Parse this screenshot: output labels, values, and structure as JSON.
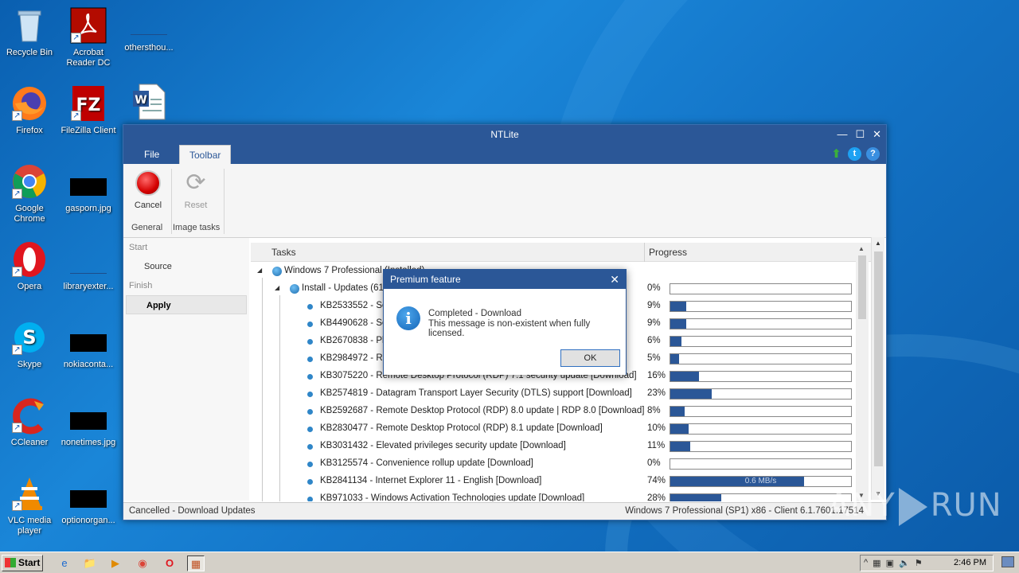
{
  "desktop": {
    "icons": [
      {
        "label": "Recycle Bin"
      },
      {
        "label": "Acrobat Reader DC"
      },
      {
        "label": "othersthou..."
      },
      {
        "label": "Firefox"
      },
      {
        "label": "FileZilla Client"
      },
      {
        "label": "Google Chrome"
      },
      {
        "label": "gasporn.jpg"
      },
      {
        "label": "Opera"
      },
      {
        "label": "libraryexter..."
      },
      {
        "label": "Skype"
      },
      {
        "label": "nokiaconta..."
      },
      {
        "label": "CCleaner"
      },
      {
        "label": "nonetimes.jpg"
      },
      {
        "label": "VLC media player"
      },
      {
        "label": "optionorgan..."
      }
    ]
  },
  "window": {
    "title": "NTLite",
    "menu": {
      "file": "File",
      "toolbar": "Toolbar"
    },
    "ribbon": {
      "cancel": "Cancel",
      "reset": "Image tasks",
      "reset_label": "Reset",
      "group_general": "General",
      "group_image_tasks": "Image tasks"
    },
    "sidenav": {
      "start": "Start",
      "source": "Source",
      "finish": "Finish",
      "apply": "Apply"
    },
    "table": {
      "col_tasks": "Tasks",
      "col_progress": "Progress",
      "root": "Windows 7 Professional  (Installed)",
      "group": "Install - Updates (61)",
      "group_pct": "0%",
      "rows": [
        {
          "label": "KB2533552 - Ser",
          "pct": "9%",
          "progress": 9
        },
        {
          "label": "KB4490628 - Ser",
          "pct": "9%",
          "progress": 9
        },
        {
          "label": "KB2670838 - Pla",
          "pct": "6%",
          "progress": 6
        },
        {
          "label": "KB2984972 - Re",
          "pct": "5%",
          "progress": 5
        },
        {
          "label": "KB3075220 - Remote Desktop Protocol (RDP) 7.1 security update [Download]",
          "pct": "16%",
          "progress": 16
        },
        {
          "label": "KB2574819 - Datagram Transport Layer Security (DTLS) support [Download]",
          "pct": "23%",
          "progress": 23
        },
        {
          "label": "KB2592687 - Remote Desktop Protocol (RDP) 8.0 update | RDP 8.0 [Download]",
          "pct": "8%",
          "progress": 8
        },
        {
          "label": "KB2830477 - Remote Desktop Protocol (RDP) 8.1 update [Download]",
          "pct": "10%",
          "progress": 10
        },
        {
          "label": "KB3031432 - Elevated privileges security update [Download]",
          "pct": "11%",
          "progress": 11
        },
        {
          "label": "KB3125574 - Convenience rollup update [Download]",
          "pct": "0%",
          "progress": 0
        },
        {
          "label": "KB2841134 - Internet Explorer 11 - English [Download]",
          "pct": "74%",
          "progress": 74,
          "speed": "0.6 MB/s"
        },
        {
          "label": "KB971033 - Windows Activation Technologies update [Download]",
          "pct": "28%",
          "progress": 28
        }
      ]
    },
    "status": {
      "left": "Cancelled - Download Updates",
      "right": "Windows 7 Professional (SP1) x86 - Client 6.1.7601.17514"
    }
  },
  "dialog": {
    "title": "Premium feature",
    "line1": "Completed - Download",
    "line2": "This message is non-existent when fully licensed.",
    "ok": "OK"
  },
  "taskbar": {
    "start": "Start",
    "clock": "2:46 PM"
  },
  "watermark": {
    "left": "ANY",
    "right": "RUN"
  },
  "colors": {
    "accent": "#2b5797",
    "progress_fill": "#2b5797"
  }
}
